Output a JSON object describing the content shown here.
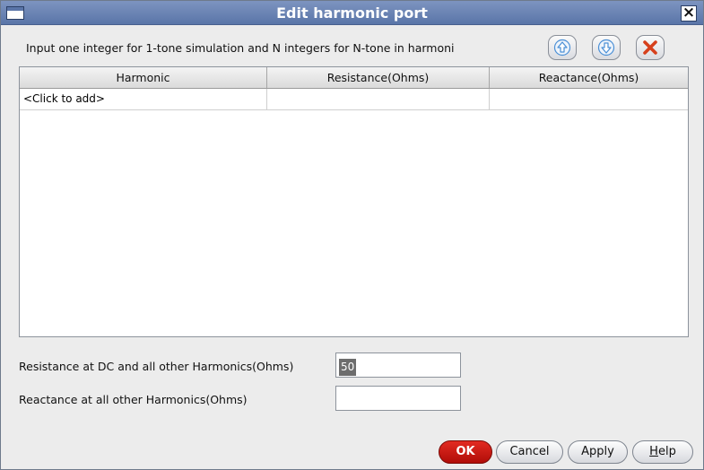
{
  "window": {
    "title": "Edit harmonic port"
  },
  "instruction": "Input one integer for 1-tone simulation and N integers for N-tone in harmoni",
  "toolbar": {
    "move_up_icon": "arrow-up-icon",
    "move_down_icon": "arrow-down-icon",
    "delete_icon": "delete-x-icon"
  },
  "table": {
    "columns": [
      "Harmonic",
      "Resistance(Ohms)",
      "Reactance(Ohms)"
    ],
    "rows": [
      [
        "<Click to add>",
        "",
        ""
      ]
    ]
  },
  "form": {
    "resistance_label": "Resistance at DC and all other Harmonics(Ohms)",
    "resistance_value": "50",
    "reactance_label": "Reactance at all other Harmonics(Ohms)",
    "reactance_value": ""
  },
  "buttons": {
    "ok": "OK",
    "cancel": "Cancel",
    "apply": "Apply",
    "help_first": "H",
    "help_rest": "elp"
  },
  "colors": {
    "title_bar": "#5a75a8",
    "ok_button": "#c8140e",
    "delete_icon": "#d6401d",
    "arrow_icon": "#4a8fd6"
  }
}
